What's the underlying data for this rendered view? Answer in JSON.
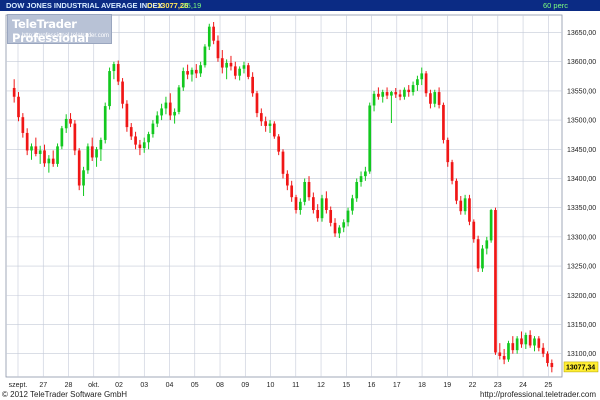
{
  "header": {
    "title": "DOW JONES INDUSTRIAL AVERAGE INDEX",
    "last_label": "C: 13077,26",
    "change_label": "-25,19",
    "period_label": "60 perc"
  },
  "logo": {
    "name": "TeleTrader Professional",
    "url": "http://professional.teletrader.com"
  },
  "footer": {
    "copyright": "© 2012 TeleTrader Software GmbH",
    "url": "http://professional.teletrader.com"
  },
  "colors": {
    "up": "#12c81e",
    "down": "#f01616",
    "grid": "#c4cad8",
    "title_bg": "#0b2b84",
    "last_price_bg": "#ffee33"
  },
  "chart_data": {
    "type": "candlestick",
    "title": "DOW JONES INDUSTRIAL AVERAGE INDEX",
    "interval": "60 perc",
    "ylim": [
      13060,
      13680
    ],
    "y_ticks": [
      "13650,00",
      "13600,00",
      "13550,00",
      "13500,00",
      "13450,00",
      "13400,00",
      "13350,00",
      "13300,00",
      "13250,00",
      "13200,00",
      "13150,00",
      "13100,00"
    ],
    "y_tick_values": [
      13650,
      13600,
      13550,
      13500,
      13450,
      13400,
      13350,
      13300,
      13250,
      13200,
      13150,
      13100
    ],
    "x_labels": [
      "szept.",
      "27",
      "28",
      "okt.",
      "02",
      "03",
      "04",
      "05",
      "08",
      "09",
      "10",
      "11",
      "12",
      "15",
      "16",
      "17",
      "18",
      "19",
      "22",
      "23",
      "24",
      "25"
    ],
    "last_price": 13077.26,
    "last_price_label": "13077,34",
    "grid": true,
    "candles": [
      [
        13555,
        13570,
        13530,
        13540
      ],
      [
        13540,
        13548,
        13498,
        13505
      ],
      [
        13505,
        13512,
        13470,
        13478
      ],
      [
        13478,
        13486,
        13440,
        13448
      ],
      [
        13448,
        13460,
        13432,
        13455
      ],
      [
        13455,
        13470,
        13438,
        13442
      ],
      [
        13442,
        13456,
        13425,
        13448
      ],
      [
        13448,
        13458,
        13420,
        13426
      ],
      [
        13426,
        13440,
        13410,
        13434
      ],
      [
        13434,
        13448,
        13420,
        13425
      ],
      [
        13425,
        13460,
        13420,
        13455
      ],
      [
        13455,
        13490,
        13450,
        13486
      ],
      [
        13486,
        13510,
        13478,
        13502
      ],
      [
        13502,
        13512,
        13488,
        13494
      ],
      [
        13494,
        13500,
        13440,
        13448
      ],
      [
        13448,
        13452,
        13380,
        13388
      ],
      [
        13388,
        13420,
        13370,
        13414
      ],
      [
        13414,
        13460,
        13408,
        13455
      ],
      [
        13455,
        13470,
        13430,
        13436
      ],
      [
        13436,
        13454,
        13420,
        13450
      ],
      [
        13450,
        13470,
        13430,
        13466
      ],
      [
        13466,
        13530,
        13460,
        13524
      ],
      [
        13524,
        13590,
        13518,
        13584
      ],
      [
        13584,
        13600,
        13570,
        13596
      ],
      [
        13596,
        13602,
        13560,
        13566
      ],
      [
        13566,
        13572,
        13520,
        13528
      ],
      [
        13528,
        13534,
        13480,
        13488
      ],
      [
        13488,
        13495,
        13466,
        13472
      ],
      [
        13472,
        13480,
        13450,
        13458
      ],
      [
        13458,
        13466,
        13440,
        13452
      ],
      [
        13452,
        13470,
        13444,
        13462
      ],
      [
        13462,
        13480,
        13450,
        13476
      ],
      [
        13476,
        13500,
        13470,
        13494
      ],
      [
        13494,
        13515,
        13488,
        13508
      ],
      [
        13508,
        13528,
        13500,
        13520
      ],
      [
        13520,
        13540,
        13510,
        13530
      ],
      [
        13530,
        13546,
        13500,
        13508
      ],
      [
        13508,
        13520,
        13494,
        13514
      ],
      [
        13514,
        13560,
        13510,
        13556
      ],
      [
        13556,
        13590,
        13550,
        13584
      ],
      [
        13584,
        13595,
        13570,
        13578
      ],
      [
        13578,
        13590,
        13566,
        13586
      ],
      [
        13586,
        13596,
        13572,
        13580
      ],
      [
        13580,
        13600,
        13574,
        13594
      ],
      [
        13594,
        13630,
        13590,
        13626
      ],
      [
        13626,
        13665,
        13620,
        13660
      ],
      [
        13660,
        13668,
        13630,
        13636
      ],
      [
        13636,
        13645,
        13600,
        13606
      ],
      [
        13606,
        13620,
        13580,
        13590
      ],
      [
        13590,
        13604,
        13570,
        13598
      ],
      [
        13598,
        13610,
        13585,
        13592
      ],
      [
        13592,
        13600,
        13570,
        13576
      ],
      [
        13576,
        13592,
        13568,
        13588
      ],
      [
        13588,
        13600,
        13580,
        13594
      ],
      [
        13594,
        13598,
        13570,
        13574
      ],
      [
        13574,
        13582,
        13540,
        13546
      ],
      [
        13546,
        13550,
        13505,
        13512
      ],
      [
        13512,
        13520,
        13490,
        13498
      ],
      [
        13498,
        13506,
        13480,
        13490
      ],
      [
        13490,
        13500,
        13478,
        13494
      ],
      [
        13494,
        13498,
        13468,
        13472
      ],
      [
        13472,
        13476,
        13440,
        13446
      ],
      [
        13446,
        13450,
        13400,
        13408
      ],
      [
        13408,
        13414,
        13380,
        13388
      ],
      [
        13388,
        13396,
        13360,
        13368
      ],
      [
        13368,
        13372,
        13340,
        13346
      ],
      [
        13346,
        13366,
        13338,
        13360
      ],
      [
        13360,
        13400,
        13354,
        13394
      ],
      [
        13394,
        13404,
        13362,
        13368
      ],
      [
        13368,
        13376,
        13340,
        13346
      ],
      [
        13346,
        13356,
        13326,
        13332
      ],
      [
        13332,
        13372,
        13326,
        13366
      ],
      [
        13366,
        13378,
        13340,
        13346
      ],
      [
        13346,
        13352,
        13318,
        13324
      ],
      [
        13324,
        13332,
        13300,
        13306
      ],
      [
        13306,
        13320,
        13298,
        13316
      ],
      [
        13316,
        13330,
        13308,
        13325
      ],
      [
        13325,
        13350,
        13318,
        13345
      ],
      [
        13345,
        13372,
        13338,
        13366
      ],
      [
        13366,
        13400,
        13360,
        13394
      ],
      [
        13394,
        13412,
        13386,
        13404
      ],
      [
        13404,
        13420,
        13396,
        13412
      ],
      [
        13412,
        13530,
        13408,
        13525
      ],
      [
        13525,
        13550,
        13515,
        13545
      ],
      [
        13545,
        13556,
        13535,
        13540
      ],
      [
        13540,
        13552,
        13530,
        13548
      ],
      [
        13548,
        13556,
        13536,
        13542
      ],
      [
        13542,
        13550,
        13495,
        13548
      ],
      [
        13548,
        13555,
        13538,
        13544
      ],
      [
        13544,
        13552,
        13534,
        13540
      ],
      [
        13540,
        13556,
        13535,
        13552
      ],
      [
        13552,
        13560,
        13540,
        13548
      ],
      [
        13548,
        13566,
        13542,
        13560
      ],
      [
        13560,
        13576,
        13550,
        13570
      ],
      [
        13570,
        13590,
        13560,
        13580
      ],
      [
        13580,
        13584,
        13540,
        13546
      ],
      [
        13546,
        13552,
        13520,
        13528
      ],
      [
        13528,
        13552,
        13522,
        13548
      ],
      [
        13548,
        13556,
        13520,
        13526
      ],
      [
        13526,
        13530,
        13460,
        13466
      ],
      [
        13466,
        13470,
        13420,
        13428
      ],
      [
        13428,
        13432,
        13390,
        13396
      ],
      [
        13396,
        13400,
        13356,
        13362
      ],
      [
        13362,
        13370,
        13338,
        13344
      ],
      [
        13344,
        13372,
        13338,
        13366
      ],
      [
        13366,
        13372,
        13320,
        13326
      ],
      [
        13326,
        13330,
        13290,
        13296
      ],
      [
        13296,
        13302,
        13240,
        13246
      ],
      [
        13246,
        13286,
        13240,
        13280
      ],
      [
        13280,
        13300,
        13270,
        13294
      ],
      [
        13294,
        13348,
        13290,
        13346
      ],
      [
        13346,
        13350,
        13098,
        13102
      ],
      [
        13102,
        13118,
        13090,
        13096
      ],
      [
        13096,
        13108,
        13082,
        13090
      ],
      [
        13090,
        13122,
        13086,
        13118
      ],
      [
        13118,
        13130,
        13100,
        13106
      ],
      [
        13106,
        13130,
        13100,
        13126
      ],
      [
        13126,
        13138,
        13110,
        13116
      ],
      [
        13116,
        13136,
        13108,
        13132
      ],
      [
        13132,
        13140,
        13110,
        13114
      ],
      [
        13114,
        13130,
        13104,
        13126
      ],
      [
        13126,
        13130,
        13104,
        13110
      ],
      [
        13110,
        13118,
        13094,
        13100
      ],
      [
        13100,
        13104,
        13078,
        13084
      ],
      [
        13084,
        13090,
        13068,
        13077
      ]
    ]
  }
}
